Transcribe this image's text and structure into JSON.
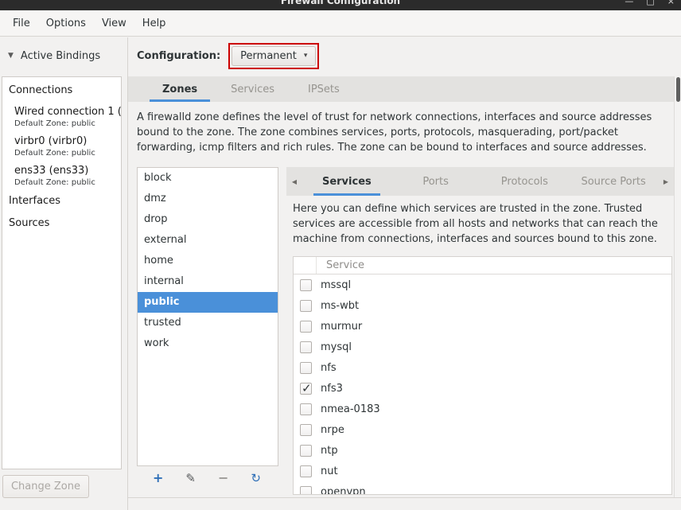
{
  "window": {
    "title": "Firewall Configuration",
    "controls": {
      "minimize": "—",
      "maximize": "□",
      "close": "×"
    }
  },
  "menubar": {
    "items": [
      "File",
      "Options",
      "View",
      "Help"
    ]
  },
  "sidebar": {
    "header": "Active Bindings",
    "sections": {
      "connections": "Connections",
      "interfaces": "Interfaces",
      "sources": "Sources"
    },
    "connections": [
      {
        "name": "Wired connection 1 (",
        "zone": "Default Zone: public"
      },
      {
        "name": "virbr0 (virbr0)",
        "zone": "Default Zone: public"
      },
      {
        "name": "ens33 (ens33)",
        "zone": "Default Zone: public"
      }
    ],
    "change_zone_label": "Change Zone"
  },
  "config": {
    "label": "Configuration:",
    "value": "Permanent"
  },
  "main_tabs": [
    {
      "label": "Zones",
      "active": true
    },
    {
      "label": "Services",
      "active": false
    },
    {
      "label": "IPSets",
      "active": false
    }
  ],
  "zone_description": "A firewalld zone defines the level of trust for network connections, interfaces and source addresses bound to the zone. The zone combines services, ports, protocols, masquerading, port/packet forwarding, icmp filters and rich rules. The zone can be bound to interfaces and source addresses.",
  "zones": {
    "selected": "public",
    "items": [
      {
        "label": "block",
        "selected": false
      },
      {
        "label": "dmz",
        "selected": false
      },
      {
        "label": "drop",
        "selected": false
      },
      {
        "label": "external",
        "selected": false
      },
      {
        "label": "home",
        "selected": false
      },
      {
        "label": "internal",
        "selected": false
      },
      {
        "label": "public",
        "selected": true
      },
      {
        "label": "trusted",
        "selected": false
      },
      {
        "label": "work",
        "selected": false
      }
    ]
  },
  "detail_tabs": [
    {
      "label": "Services",
      "active": true
    },
    {
      "label": "Ports",
      "active": false
    },
    {
      "label": "Protocols",
      "active": false
    },
    {
      "label": "Source Ports",
      "active": false
    }
  ],
  "services_description": "Here you can define which services are trusted in the zone. Trusted services are accessible from all hosts and networks that can reach the machine from connections, interfaces and sources bound to this zone.",
  "services_table": {
    "column_header": "Service",
    "rows": [
      {
        "name": "mssql",
        "checked": false
      },
      {
        "name": "ms-wbt",
        "checked": false
      },
      {
        "name": "murmur",
        "checked": false
      },
      {
        "name": "mysql",
        "checked": false
      },
      {
        "name": "nfs",
        "checked": false
      },
      {
        "name": "nfs3",
        "checked": true
      },
      {
        "name": "nmea-0183",
        "checked": false
      },
      {
        "name": "nrpe",
        "checked": false
      },
      {
        "name": "ntp",
        "checked": false
      },
      {
        "name": "nut",
        "checked": false
      },
      {
        "name": "openvpn",
        "checked": false
      }
    ]
  },
  "icons": {
    "expander": "▼",
    "combo_arrow": "▾",
    "add": "+",
    "edit": "✎",
    "remove": "−",
    "reload": "↻",
    "tab_left": "◀",
    "tab_right": "▶"
  },
  "colors": {
    "selection": "#4a90d9",
    "tab_underline": "#4a90d9",
    "annotation": "#cc0000"
  }
}
